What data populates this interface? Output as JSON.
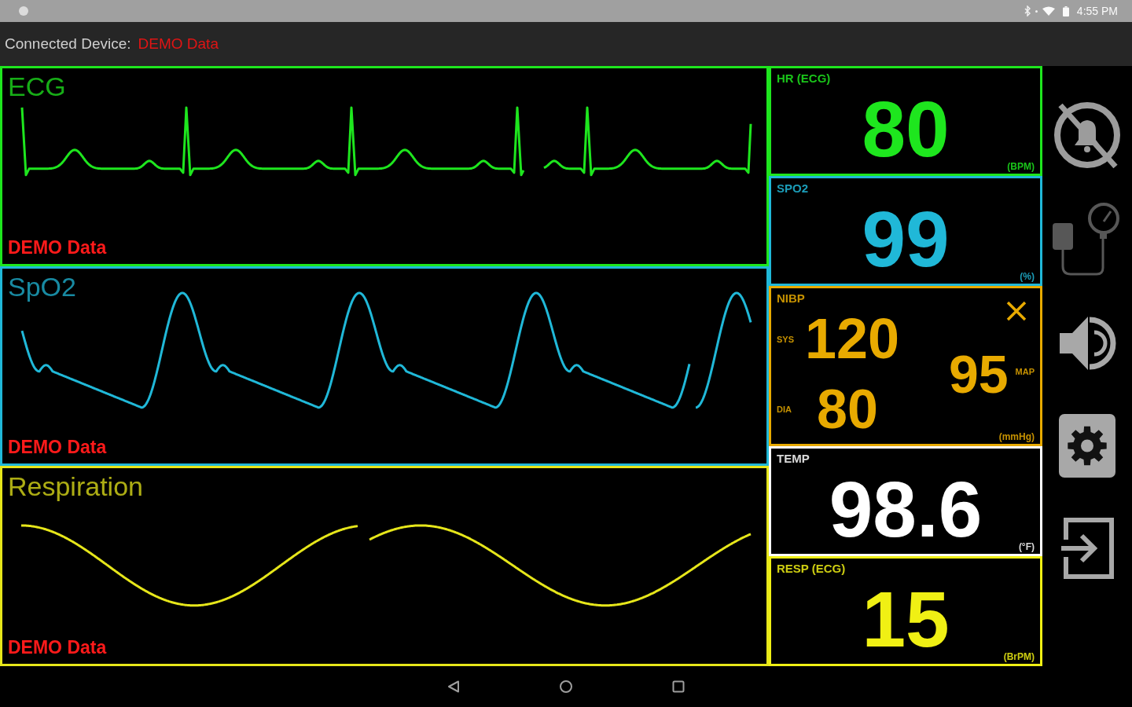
{
  "status_bar": {
    "time": "4:55 PM"
  },
  "app_bar": {
    "label": "Connected Device:",
    "device": "DEMO Data"
  },
  "waveforms": [
    {
      "kind": "ecg",
      "title": "ECG",
      "source": "DEMO Data",
      "color": "#1ee61e"
    },
    {
      "kind": "pleth",
      "title": "SpO2",
      "source": "DEMO Data",
      "color": "#20b8d8"
    },
    {
      "kind": "resp",
      "title": "Respiration",
      "source": "DEMO Data",
      "color": "#e6e61a"
    }
  ],
  "vitals": [
    {
      "kind": "single",
      "label": "HR (ECG)",
      "value": "80",
      "unit": "(BPM)",
      "color": "#1ee61e"
    },
    {
      "kind": "single",
      "label": "SPO2",
      "value": "99",
      "unit": "(%)",
      "color": "#20b8d8"
    },
    {
      "kind": "nibp",
      "label": "NIBP",
      "systolic": {
        "label": "SYS",
        "value": "120"
      },
      "diastolic": {
        "label": "DIA",
        "value": "80"
      },
      "mean": {
        "label": "MAP",
        "value": "95"
      },
      "unit": "(mmHg)",
      "color": "#e8aa00"
    },
    {
      "kind": "single",
      "label": "TEMP",
      "value": "98.6",
      "unit": "(°F)",
      "color": "#ffffff"
    },
    {
      "kind": "single",
      "label": "RESP (ECG)",
      "value": "15",
      "unit": "(BrPM)",
      "color": "#f0f014"
    }
  ]
}
